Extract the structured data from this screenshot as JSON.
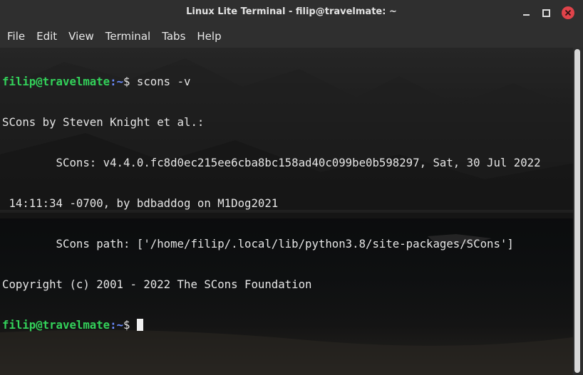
{
  "window": {
    "title": "Linux Lite Terminal - filip@travelmate: ~"
  },
  "menu": {
    "items": [
      "File",
      "Edit",
      "View",
      "Terminal",
      "Tabs",
      "Help"
    ]
  },
  "terminal": {
    "prompt_user": "filip@travelmate",
    "prompt_path": ":~",
    "prompt_symbol": "$ ",
    "command": "scons -v",
    "output": [
      "SCons by Steven Knight et al.:",
      "        SCons: v4.4.0.fc8d0ec215ee6cba8bc158ad40c099be0b598297, Sat, 30 Jul 2022",
      " 14:11:34 -0700, by bdbaddog on M1Dog2021",
      "        SCons path: ['/home/filip/.local/lib/python3.8/site-packages/SCons']",
      "Copyright (c) 2001 - 2022 The SCons Foundation"
    ]
  },
  "colors": {
    "prompt_user": "#33d15a",
    "prompt_path": "#6b8cff",
    "close_button": "#e0434a",
    "text": "#e6e6e6"
  },
  "icons": {
    "minimize": "minimize-icon",
    "maximize": "maximize-icon",
    "close": "close-icon"
  }
}
